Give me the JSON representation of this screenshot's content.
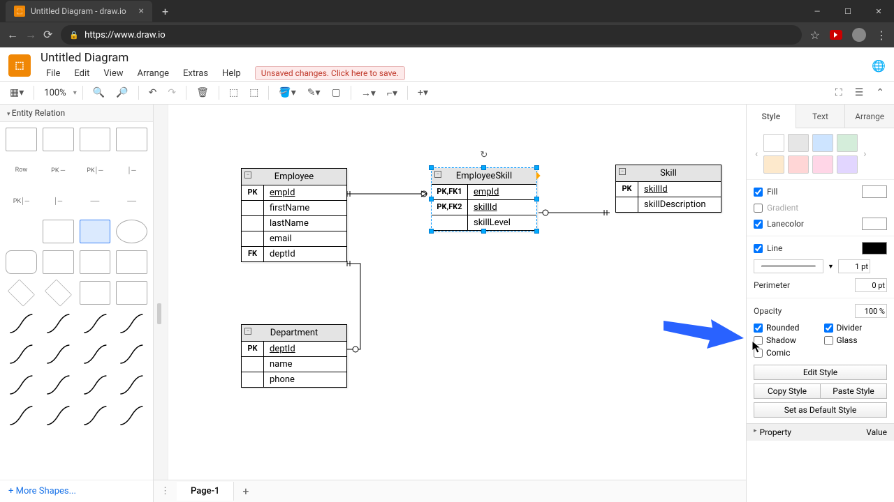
{
  "browser": {
    "tab_title": "Untitled Diagram - draw.io",
    "url_host": "https://www.draw.io",
    "url_prefix": ""
  },
  "app": {
    "title": "Untitled Diagram",
    "menus": [
      "File",
      "Edit",
      "View",
      "Arrange",
      "Extras",
      "Help"
    ],
    "save_alert": "Unsaved changes. Click here to save."
  },
  "toolbar": {
    "zoom": "100%"
  },
  "palette": {
    "section": "Entity Relation",
    "row_label": "Row",
    "more_shapes": "+ More Shapes..."
  },
  "canvas": {
    "tables": {
      "employee": {
        "title": "Employee",
        "rows": [
          {
            "key": "PK",
            "val": "empId",
            "underline": true
          },
          {
            "key": "",
            "val": "firstName"
          },
          {
            "key": "",
            "val": "lastName"
          },
          {
            "key": "",
            "val": "email"
          },
          {
            "key": "FK",
            "val": "deptId"
          }
        ]
      },
      "employeeSkill": {
        "title": "EmployeeSkill",
        "rows": [
          {
            "key": "PK,FK1",
            "val": "empId",
            "underline": true
          },
          {
            "key": "PK,FK2",
            "val": "skillId",
            "underline": true
          },
          {
            "key": "",
            "val": "skillLevel"
          }
        ]
      },
      "skill": {
        "title": "Skill",
        "rows": [
          {
            "key": "PK",
            "val": "skillId",
            "underline": true
          },
          {
            "key": "",
            "val": "skillDescription"
          }
        ]
      },
      "department": {
        "title": "Department",
        "rows": [
          {
            "key": "PK",
            "val": "deptId",
            "underline": true
          },
          {
            "key": "",
            "val": "name"
          },
          {
            "key": "",
            "val": "phone"
          }
        ]
      }
    }
  },
  "pages": {
    "current": "Page-1"
  },
  "right": {
    "tabs": [
      "Style",
      "Text",
      "Arrange"
    ],
    "swatches": [
      "#ffffff",
      "#e6e6e6",
      "#cde4ff",
      "#d4edda",
      "#fde9cc",
      "#ffd6d6",
      "#ffd6e7",
      "#e2d6ff"
    ],
    "fill_checked": true,
    "fill_color": "#ffffff",
    "gradient_checked": false,
    "lanecolor_checked": true,
    "lanecolor": "#ffffff",
    "line_checked": true,
    "line_color": "#000000",
    "line_width": "1 pt",
    "perimeter": "0 pt",
    "opacity": "100 %",
    "rounded": true,
    "divider": true,
    "shadow": false,
    "glass": false,
    "comic": false,
    "labels": {
      "fill": "Fill",
      "gradient": "Gradient",
      "lanecolor": "Lanecolor",
      "line": "Line",
      "perimeter": "Perimeter",
      "opacity": "Opacity",
      "rounded": "Rounded",
      "divider": "Divider",
      "shadow": "Shadow",
      "glass": "Glass",
      "comic": "Comic",
      "edit_style": "Edit Style",
      "copy_style": "Copy Style",
      "paste_style": "Paste Style",
      "default_style": "Set as Default Style",
      "property": "Property",
      "value": "Value"
    }
  }
}
